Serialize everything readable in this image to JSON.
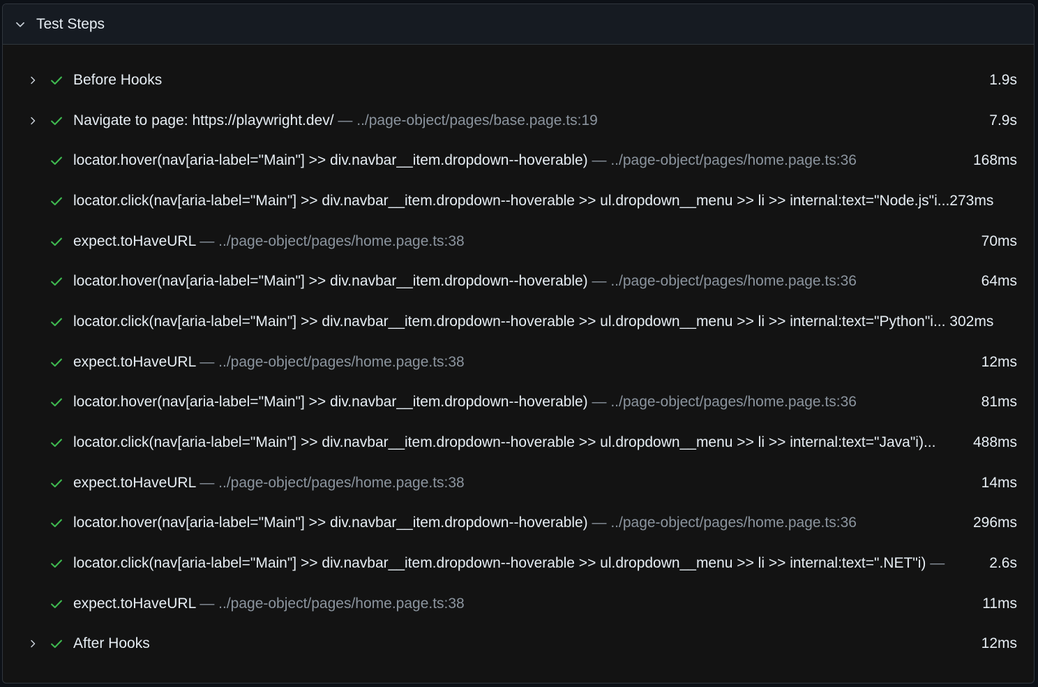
{
  "panel": {
    "title": "Test Steps",
    "colors": {
      "background": "#131313",
      "header": "#161b22",
      "border": "#30363d",
      "text": "#e6edf3",
      "muted": "#8b949e",
      "check": "#3fb950"
    },
    "icons": {
      "collapse": "chevron-down-icon",
      "expand": "chevron-right-icon",
      "status": "check-icon"
    }
  },
  "steps": [
    {
      "expandable": true,
      "title": "Before Hooks",
      "location": "",
      "duration": "1.9s"
    },
    {
      "expandable": true,
      "title": "Navigate to page: https://playwright.dev/",
      "location": " — ../page-object/pages/base.page.ts:19",
      "duration": "7.9s"
    },
    {
      "expandable": false,
      "title": "locator.hover(nav[aria-label=\"Main\"] >> div.navbar__item.dropdown--hoverable)",
      "location": " — ../page-object/pages/home.page.ts:36",
      "duration": "168ms"
    },
    {
      "expandable": false,
      "title": "locator.click(nav[aria-label=\"Main\"] >> div.navbar__item.dropdown--hoverable >> ul.dropdown__menu >> li >> internal:text=\"Node.js\"i...273ms",
      "location": "",
      "duration": ""
    },
    {
      "expandable": false,
      "title": "expect.toHaveURL",
      "location": " — ../page-object/pages/home.page.ts:38",
      "duration": "70ms"
    },
    {
      "expandable": false,
      "title": "locator.hover(nav[aria-label=\"Main\"] >> div.navbar__item.dropdown--hoverable)",
      "location": " — ../page-object/pages/home.page.ts:36",
      "duration": "64ms"
    },
    {
      "expandable": false,
      "title": "locator.click(nav[aria-label=\"Main\"] >> div.navbar__item.dropdown--hoverable >> ul.dropdown__menu >> li >> internal:text=\"Python\"i... 302ms",
      "location": "",
      "duration": ""
    },
    {
      "expandable": false,
      "title": "expect.toHaveURL",
      "location": " — ../page-object/pages/home.page.ts:38",
      "duration": "12ms"
    },
    {
      "expandable": false,
      "title": "locator.hover(nav[aria-label=\"Main\"] >> div.navbar__item.dropdown--hoverable)",
      "location": " — ../page-object/pages/home.page.ts:36",
      "duration": "81ms"
    },
    {
      "expandable": false,
      "title": "locator.click(nav[aria-label=\"Main\"] >> div.navbar__item.dropdown--hoverable >> ul.dropdown__menu >> li >> internal:text=\"Java\"i)...",
      "location": "",
      "duration": "488ms"
    },
    {
      "expandable": false,
      "title": "expect.toHaveURL",
      "location": " — ../page-object/pages/home.page.ts:38",
      "duration": "14ms"
    },
    {
      "expandable": false,
      "title": "locator.hover(nav[aria-label=\"Main\"] >> div.navbar__item.dropdown--hoverable)",
      "location": " — ../page-object/pages/home.page.ts:36",
      "duration": "296ms"
    },
    {
      "expandable": false,
      "title": "locator.click(nav[aria-label=\"Main\"] >> div.navbar__item.dropdown--hoverable >> ul.dropdown__menu >> li >> internal:text=\".NET\"i)",
      "location": " — .....",
      "duration": "2.6s"
    },
    {
      "expandable": false,
      "title": "expect.toHaveURL",
      "location": " — ../page-object/pages/home.page.ts:38",
      "duration": "11ms"
    },
    {
      "expandable": true,
      "title": "After Hooks",
      "location": "",
      "duration": "12ms"
    }
  ]
}
